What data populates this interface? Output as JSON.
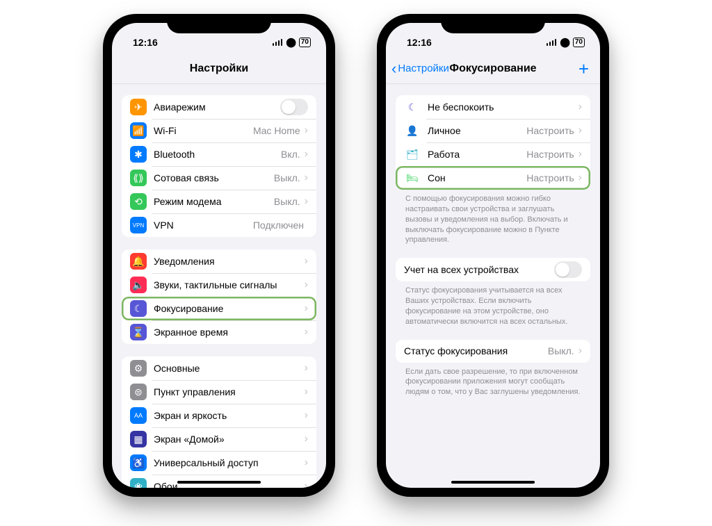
{
  "status": {
    "time": "12:16",
    "battery": "70"
  },
  "phone1": {
    "title": "Настройки",
    "groups": [
      {
        "rows": [
          {
            "icon": {
              "bg": "#ff9500",
              "glyph": "✈"
            },
            "label": "Авиарежим",
            "toggle": true
          },
          {
            "icon": {
              "bg": "#007aff",
              "glyph": "📶"
            },
            "label": "Wi-Fi",
            "value": "Mac Home",
            "chevron": true
          },
          {
            "icon": {
              "bg": "#007aff",
              "glyph": "✱"
            },
            "label": "Bluetooth",
            "value": "Вкл.",
            "chevron": true
          },
          {
            "icon": {
              "bg": "#34c759",
              "glyph": "⟪⟫"
            },
            "label": "Сотовая связь",
            "value": "Выкл.",
            "chevron": true
          },
          {
            "icon": {
              "bg": "#34c759",
              "glyph": "⟲"
            },
            "label": "Режим модема",
            "value": "Выкл.",
            "chevron": true
          },
          {
            "icon": {
              "bg": "#007aff",
              "glyph": "VPN",
              "fs": "8px"
            },
            "label": "VPN",
            "value": "Подключен"
          }
        ]
      },
      {
        "rows": [
          {
            "icon": {
              "bg": "#ff3b30",
              "glyph": "🔔"
            },
            "label": "Уведомления",
            "chevron": true
          },
          {
            "icon": {
              "bg": "#ff2d55",
              "glyph": "🔈"
            },
            "label": "Звуки, тактильные сигналы",
            "chevron": true
          },
          {
            "icon": {
              "bg": "#5756d6",
              "glyph": "☾"
            },
            "label": "Фокусирование",
            "chevron": true,
            "highlight": true
          },
          {
            "icon": {
              "bg": "#5756d6",
              "glyph": "⌛"
            },
            "label": "Экранное время",
            "chevron": true
          }
        ]
      },
      {
        "rows": [
          {
            "icon": {
              "bg": "#8e8e93",
              "glyph": "⚙"
            },
            "label": "Основные",
            "chevron": true
          },
          {
            "icon": {
              "bg": "#8e8e93",
              "glyph": "⊜"
            },
            "label": "Пункт управления",
            "chevron": true
          },
          {
            "icon": {
              "bg": "#007aff",
              "glyph": "AA",
              "fs": "9px"
            },
            "label": "Экран и яркость",
            "chevron": true
          },
          {
            "icon": {
              "bg": "#3634a3",
              "glyph": "▦"
            },
            "label": "Экран «Домой»",
            "chevron": true
          },
          {
            "icon": {
              "bg": "#007aff",
              "glyph": "♿"
            },
            "label": "Универсальный доступ",
            "chevron": true
          },
          {
            "icon": {
              "bg": "#30b0c7",
              "glyph": "❀"
            },
            "label": "Обои",
            "chevron": true
          }
        ]
      }
    ]
  },
  "phone2": {
    "back": "Настройки",
    "title": "Фокусирование",
    "groups": [
      {
        "rows": [
          {
            "icon": {
              "simple": true,
              "color": "#5756d6",
              "glyph": "☾"
            },
            "label": "Не беспокоить",
            "chevron": true
          },
          {
            "icon": {
              "simple": true,
              "color": "#0a84ff",
              "glyph": "👤"
            },
            "label": "Личное",
            "value": "Настроить",
            "chevron": true
          },
          {
            "icon": {
              "simple": true,
              "color": "#30b0c7",
              "glyph": "🗂"
            },
            "label": "Работа",
            "value": "Настроить",
            "chevron": true
          },
          {
            "icon": {
              "simple": true,
              "color": "#30d158",
              "glyph": "🛏"
            },
            "label": "Сон",
            "value": "Настроить",
            "chevron": true,
            "highlight": true
          }
        ],
        "footer": "С помощью фокусирования можно гибко настраивать свои устройства и заглушать вызовы и уведомления на выбор. Включать и выключать фокусирование можно в Пункте управления."
      },
      {
        "rows": [
          {
            "label": "Учет на всех устройствах",
            "toggle": true
          }
        ],
        "footer": "Статус фокусирования учитывается на всех Ваших устройствах. Если включить фокусирование на этом устройстве, оно автоматически включится на всех остальных."
      },
      {
        "rows": [
          {
            "label": "Статус фокусирования",
            "value": "Выкл.",
            "chevron": true
          }
        ],
        "footer": "Если дать свое разрешение, то при включенном фокусировании приложения могут сообщать людям о том, что у Вас заглушены уведомления."
      }
    ]
  }
}
